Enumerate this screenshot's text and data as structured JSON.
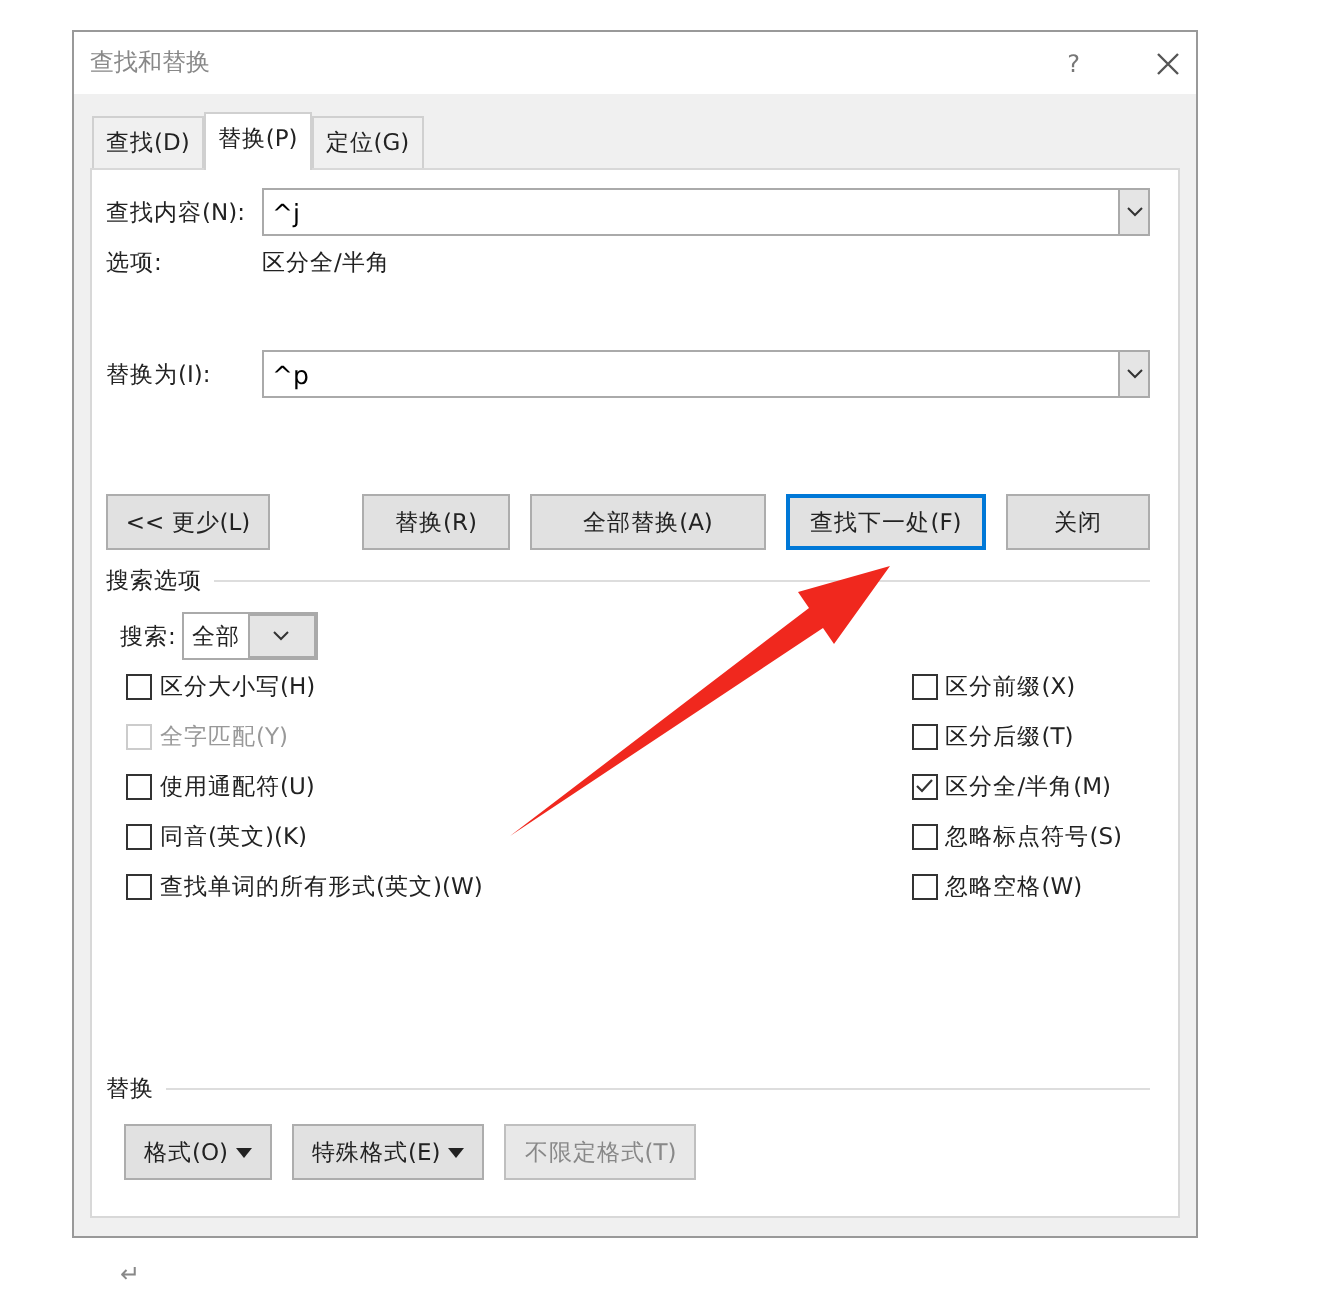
{
  "window": {
    "title": "查找和替换",
    "help": "?"
  },
  "tabs": [
    {
      "label": "查找(D)",
      "selected": false
    },
    {
      "label": "替换(P)",
      "selected": true
    },
    {
      "label": "定位(G)",
      "selected": false
    }
  ],
  "find": {
    "label": "查找内容(N):",
    "value": "^j",
    "options_label": "选项:",
    "options_value": "区分全/半角"
  },
  "replace": {
    "label": "替换为(I):",
    "value": "^p"
  },
  "more_button": {
    "label": "<< 更少(L)"
  },
  "action_buttons": [
    {
      "label": "替换(R)",
      "default": false
    },
    {
      "label": "全部替换(A)",
      "default": false
    },
    {
      "label": "查找下一处(F)",
      "default": true
    },
    {
      "label": "关闭",
      "default": false
    }
  ],
  "search_options": {
    "title": "搜索选项",
    "search_label": "搜索:",
    "search_value": "全部",
    "left": [
      {
        "label": "区分大小写(H)",
        "checked": false,
        "disabled": false
      },
      {
        "label": "全字匹配(Y)",
        "checked": false,
        "disabled": true
      },
      {
        "label": "使用通配符(U)",
        "checked": false,
        "disabled": false
      },
      {
        "label": "同音(英文)(K)",
        "checked": false,
        "disabled": false
      },
      {
        "label": "查找单词的所有形式(英文)(W)",
        "checked": false,
        "disabled": false
      }
    ],
    "right": [
      {
        "label": "区分前缀(X)",
        "checked": false,
        "disabled": false
      },
      {
        "label": "区分后缀(T)",
        "checked": false,
        "disabled": false
      },
      {
        "label": "区分全/半角(M)",
        "checked": true,
        "disabled": false
      },
      {
        "label": "忽略标点符号(S)",
        "checked": false,
        "disabled": false
      },
      {
        "label": "忽略空格(W)",
        "checked": false,
        "disabled": false
      }
    ]
  },
  "replace_section": {
    "title": "替换",
    "buttons": [
      {
        "label": "格式(O)",
        "dropdown": true,
        "disabled": false
      },
      {
        "label": "特殊格式(E)",
        "dropdown": true,
        "disabled": false
      },
      {
        "label": "不限定格式(T)",
        "dropdown": false,
        "disabled": true
      }
    ]
  },
  "document": {
    "paragraph_mark": "↵"
  }
}
